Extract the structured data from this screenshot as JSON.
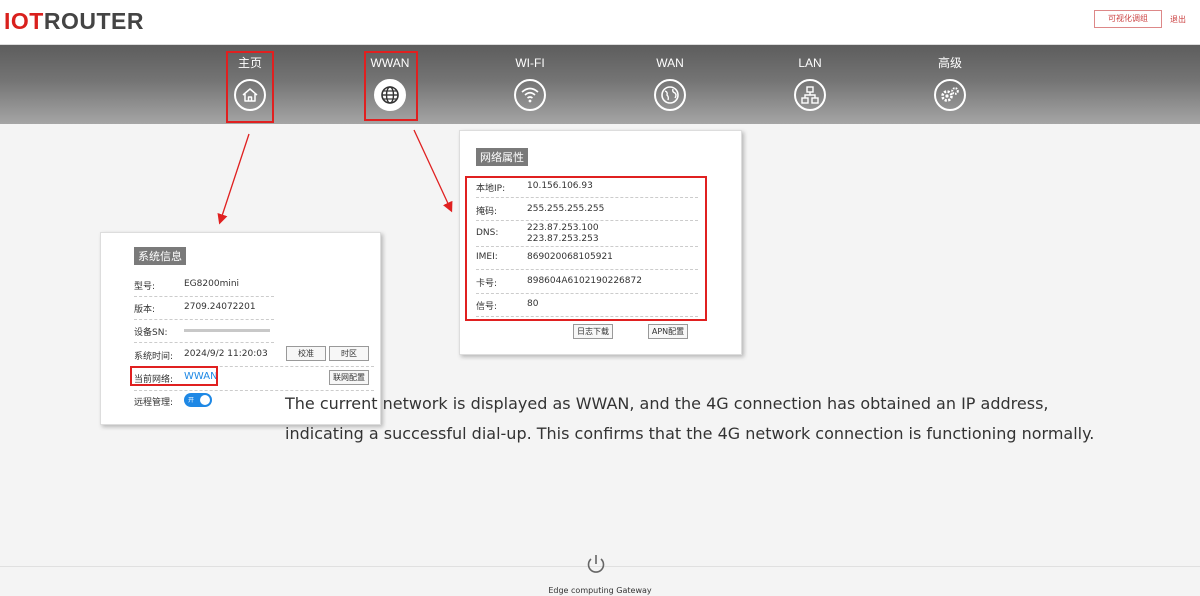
{
  "header": {
    "logo_part1": "IOT",
    "logo_part2": "ROUTER",
    "top_button": "可视化调组",
    "logout": "退出"
  },
  "nav": [
    {
      "label": "主页",
      "icon": "home-icon"
    },
    {
      "label": "WWAN",
      "icon": "globe-icon"
    },
    {
      "label": "WI-FI",
      "icon": "wifi-icon"
    },
    {
      "label": "WAN",
      "icon": "earth-icon"
    },
    {
      "label": "LAN",
      "icon": "network-icon"
    },
    {
      "label": "高级",
      "icon": "gear-icon"
    }
  ],
  "system_info": {
    "title": "系统信息",
    "model_label": "型号:",
    "model_value": "EG8200mini",
    "version_label": "版本:",
    "version_value": "2709.24072201",
    "sn_label": "设备SN:",
    "sn_value": "",
    "time_label": "系统时间:",
    "time_value": "2024/9/2 11:20:03",
    "calibrate_button": "校准",
    "timezone_button": "时区",
    "network_label": "当前网络:",
    "network_value": "WWAN",
    "net_config_button": "联网配置",
    "remote_label": "远程管理:",
    "remote_toggle_text": "开"
  },
  "network_props": {
    "title": "网络属性",
    "rows": [
      {
        "label": "本地IP:",
        "value": "10.156.106.93"
      },
      {
        "label": "掩码:",
        "value": "255.255.255.255"
      },
      {
        "label": "DNS:",
        "value": "223.87.253.100",
        "value2": "223.87.253.253"
      },
      {
        "label": "IMEI:",
        "value": "869020068105921"
      },
      {
        "label": "卡号:",
        "value": "898604A6102190226872"
      },
      {
        "label": "信号:",
        "value": "80"
      }
    ],
    "log_button": "日志下载",
    "apn_button": "APN配置"
  },
  "caption": {
    "line1": "The current network is displayed as WWAN, and the 4G connection has obtained an IP address,",
    "line2": "indicating a successful dial-up. This confirms that the 4G network connection is functioning normally."
  },
  "footer": {
    "text": "Edge computing Gateway"
  },
  "colors": {
    "accent_red": "#e02020",
    "toggle_blue": "#1e88e5",
    "nav_dark": "#5d5d5d"
  }
}
